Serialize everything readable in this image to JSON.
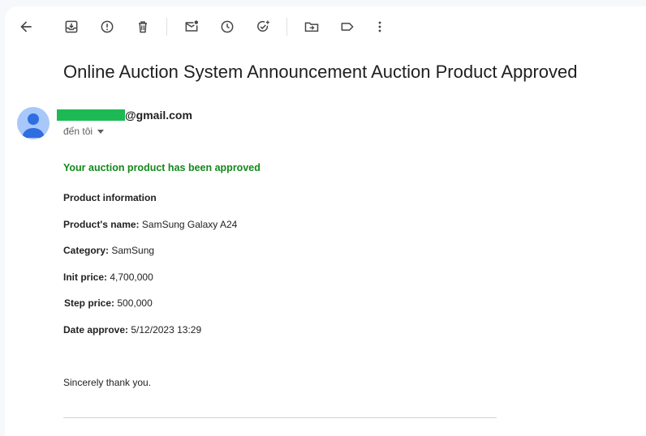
{
  "toolbar": {
    "icons": [
      "back-arrow-icon",
      "archive-icon",
      "report-spam-icon",
      "delete-icon",
      "mark-unread-icon",
      "snooze-icon",
      "add-to-tasks-icon",
      "move-to-icon",
      "label-icon",
      "more-vert-icon"
    ]
  },
  "email": {
    "subject": "Online Auction System Announcement Auction Product Approved",
    "sender_domain": "@gmail.com",
    "recipient": "đến tôi",
    "headline": "Your auction product has been approved",
    "section_title": "Product information",
    "fields": [
      {
        "label": "Product's name:",
        "value": "SamSung Galaxy A24"
      },
      {
        "label": "Category:",
        "value": "SamSung"
      },
      {
        "label": "Init price:",
        "value": "4,700,000"
      },
      {
        "label": "Step price:",
        "value": "500,000"
      },
      {
        "label": "Date approve:",
        "value": "5/12/2023 13:29"
      }
    ],
    "closing": "Sincerely thank you."
  },
  "colors": {
    "accent_green": "#12891a",
    "redaction_green": "#1db954",
    "avatar_bg": "#a8c7fa",
    "avatar_fg": "#2f6de1"
  }
}
